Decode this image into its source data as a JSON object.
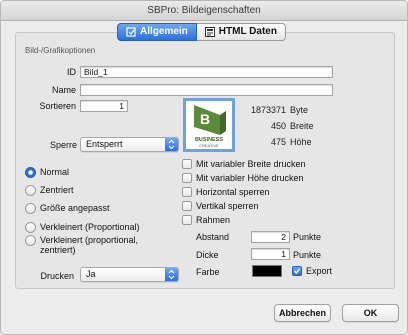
{
  "window": {
    "title": "SBPro: Bildeigenschaften"
  },
  "tabs": [
    {
      "label": "Allgemein",
      "icon": "settings-icon",
      "active": true
    },
    {
      "label": "HTML Daten",
      "icon": "html-icon",
      "active": false
    }
  ],
  "group_label": "Bild-/Grafikoptionen",
  "fields": {
    "id_label": "ID",
    "id_value": "Bild_1",
    "name_label": "Name",
    "name_value": "",
    "sort_label": "Sortieren",
    "sort_value": "1",
    "lock_label": "Sperre",
    "lock_value": "Entsperrt",
    "print_label": "Drucken",
    "print_value": "Ja"
  },
  "image_info": {
    "size_value": "1873371",
    "size_unit": "Byte",
    "width_value": "450",
    "width_unit": "Breite",
    "height_value": "475",
    "height_unit": "Höhe"
  },
  "thumbnail": {
    "logo_text_1": "BUSINESS",
    "logo_text_2": "CREATIVE"
  },
  "sizing_options": [
    {
      "label": "Normal",
      "selected": true
    },
    {
      "label": "Zentriert",
      "selected": false
    },
    {
      "label": "Größe angepasst",
      "selected": false
    },
    {
      "label": "Verkleinert (Proportional)",
      "selected": false
    },
    {
      "label": "Verkleinert (proportional, zentriert)",
      "selected": false
    }
  ],
  "checkboxes": [
    {
      "label": "Mit variabler Breite drucken",
      "checked": false
    },
    {
      "label": "Mit variabler Höhe drucken",
      "checked": false
    },
    {
      "label": "Horizontal sperren",
      "checked": false
    },
    {
      "label": "Vertikal sperren",
      "checked": false
    },
    {
      "label": "Rahmen",
      "checked": false
    }
  ],
  "frame": {
    "spacing_label": "Abstand",
    "spacing_value": "2",
    "spacing_unit": "Punkte",
    "thickness_label": "Dicke",
    "thickness_value": "1",
    "thickness_unit": "Punkte",
    "color_label": "Farbe",
    "color_value": "#000000",
    "export_label": "Export",
    "export_checked": true
  },
  "buttons": {
    "cancel": "Abbrechen",
    "ok": "OK"
  },
  "colors": {
    "accent": "#2f6ed4",
    "window_bg": "#ececec"
  }
}
